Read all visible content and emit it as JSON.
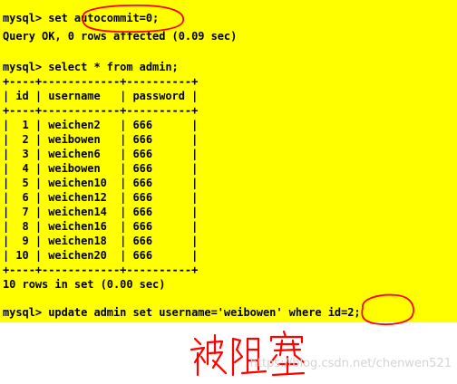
{
  "terminal": {
    "background": "#ffff00",
    "lines": [
      "mysql> set autocommit=0;",
      "Query OK, 0 rows affected (0.09 sec)",
      "",
      "mysql> select * from admin;",
      "+----+------------+----------+",
      "| id | username   | password |",
      "+----+------------+----------+",
      "|  1 | weichen2   | 666      |",
      "|  2 | weibowen   | 666      |",
      "|  3 | weichen6   | 666      |",
      "|  4 | weibowen   | 666      |",
      "|  5 | weichen10  | 666      |",
      "|  6 | weichen12  | 666      |",
      "|  7 | weichen14  | 666      |",
      "|  8 | weichen16  | 666      |",
      "|  9 | weichen18  | 666      |",
      "| 10 | weichen20  | 666      |",
      "+----+------------+----------+",
      "10 rows in set (0.00 sec)",
      "",
      "mysql> update admin set username='weibowen' where id=2;"
    ]
  },
  "annotations": {
    "highlight_color": "#ff0000",
    "circled": [
      "autocommit=0;",
      "id=2;"
    ],
    "handwriting": "被阻塞"
  },
  "watermark": "https://blog.csdn.net/chenwen521"
}
